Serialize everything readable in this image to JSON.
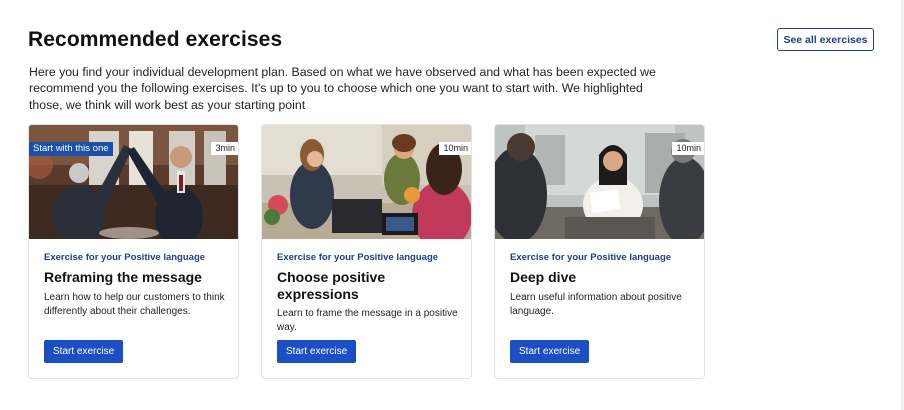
{
  "header": {
    "title": "Recommended exercises",
    "see_all_label": "See all exercises",
    "intro": "Here you find your individual development plan. Based on what we have observed and what has been expected we recommend you the following exercises. It's up to you to choose which one you want to start with. We highlighted those, we think will work best as your starting point"
  },
  "cards": [
    {
      "badge": "Start with this one",
      "duration": "3min",
      "kicker": "Exercise for your Positive language",
      "title": "Reframing the message",
      "description": "Learn how to help our customers to think differently about their challenges.",
      "button": "Start exercise"
    },
    {
      "duration": "10min",
      "kicker": "Exercise for your Positive language",
      "title": "Choose positive expressions",
      "description": "Learn to frame the message in a positive way.",
      "button": "Start exercise"
    },
    {
      "duration": "10min",
      "kicker": "Exercise for your Positive language",
      "title": "Deep dive",
      "description": "Learn useful information about positive language.",
      "button": "Start exercise"
    }
  ],
  "colors": {
    "accent": "#1c4fc4",
    "kicker": "#1c3f8c",
    "badge": "#1c4fa8"
  }
}
